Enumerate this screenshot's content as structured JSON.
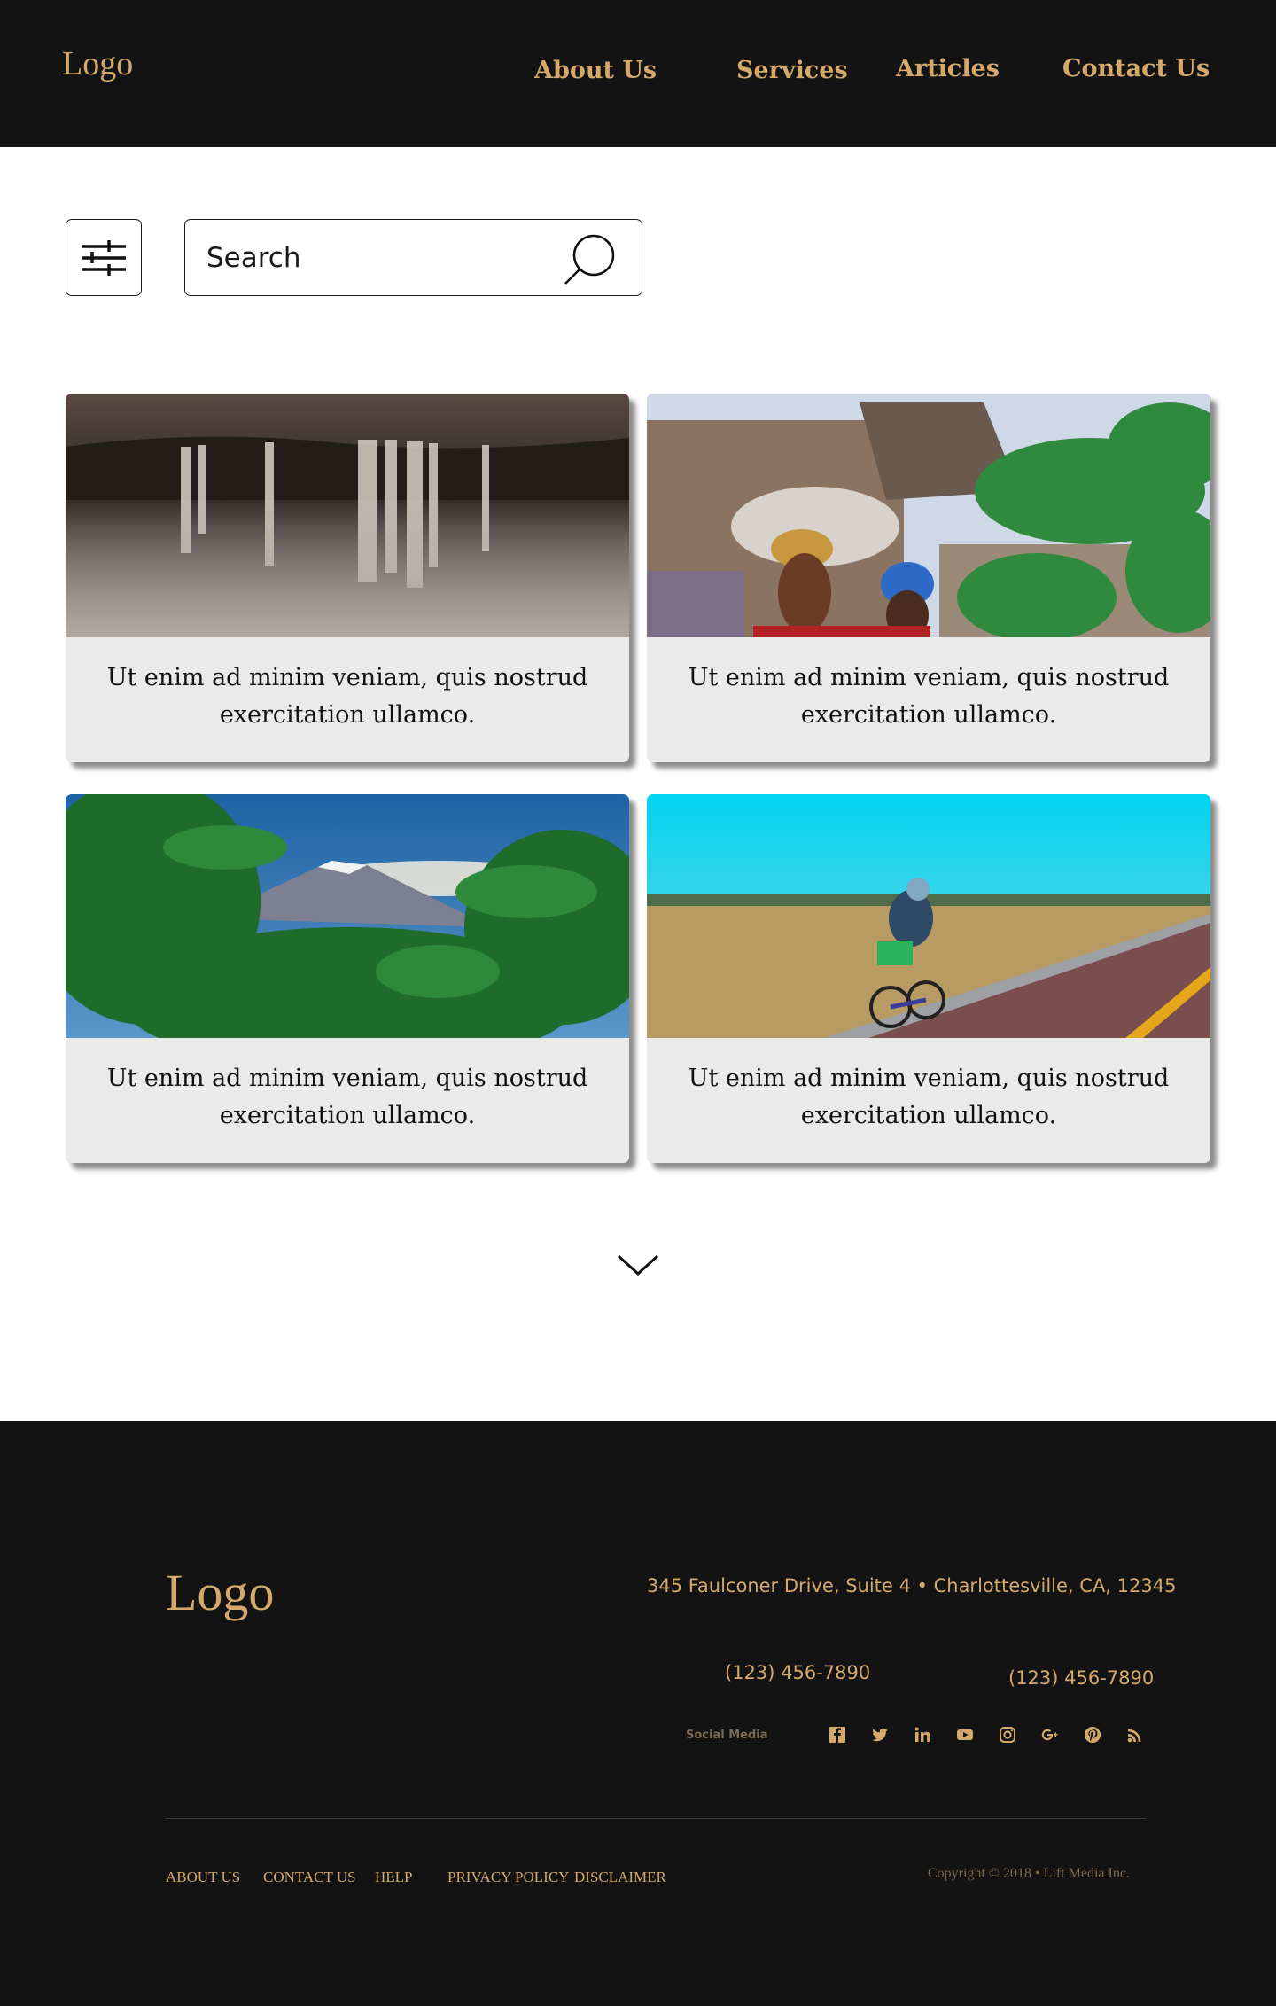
{
  "header": {
    "logo": "Logo",
    "nav": [
      "About Us",
      "Services",
      "Articles",
      "Contact Us"
    ]
  },
  "toolbar": {
    "filter_icon": "sliders-icon",
    "search_placeholder": "Search",
    "search_icon": "search-icon"
  },
  "cards": [
    {
      "text": "Ut enim ad minim veniam, quis nostrud exercitation ullamco.",
      "image": "waterfall-photo"
    },
    {
      "text": "Ut enim ad minim veniam, quis nostrud exercitation ullamco.",
      "image": "women-village-photo"
    },
    {
      "text": "Ut enim ad minim veniam, quis nostrud exercitation ullamco.",
      "image": "mountain-banana-trees-photo"
    },
    {
      "text": "Ut enim ad minim veniam, quis nostrud exercitation ullamco.",
      "image": "cyclist-road-photo"
    }
  ],
  "more_icon": "chevron-down-icon",
  "footer": {
    "logo": "Logo",
    "address": "345 Faulconer Drive, Suite 4 • Charlottesville, CA, 12345",
    "phone_1": "(123) 456-7890",
    "phone_2": "(123) 456-7890",
    "social_label": "Social Media",
    "social_icons": [
      "facebook-icon",
      "twitter-icon",
      "linkedin-icon",
      "youtube-icon",
      "instagram-icon",
      "google-plus-icon",
      "pinterest-icon",
      "rss-icon"
    ],
    "links": [
      "ABOUT US",
      "CONTACT US",
      "HELP",
      "PRIVACY POLICY",
      "DISCLAIMER"
    ],
    "copyright": "Copyright © 2018 • Lift Media Inc."
  },
  "colors": {
    "dark_bg": "#131313",
    "gold": "#d4a96a",
    "card_bg": "#eaeaea"
  }
}
